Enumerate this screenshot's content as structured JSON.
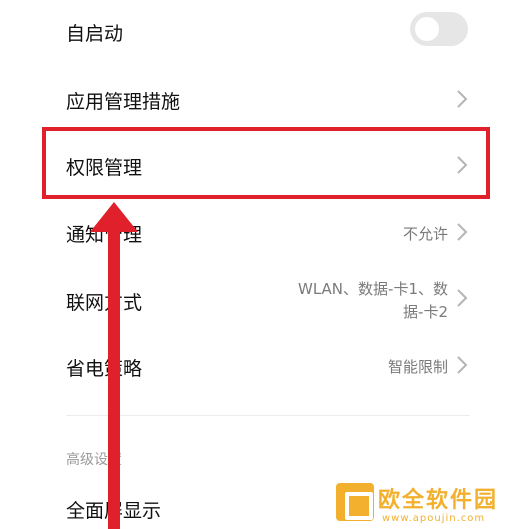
{
  "settings": {
    "auto_start": {
      "label": "自启动",
      "toggle_on": false
    },
    "app_management": {
      "label": "应用管理措施"
    },
    "permissions": {
      "label": "权限管理"
    },
    "notifications": {
      "label": "通知管理",
      "value": "不允许"
    },
    "network": {
      "label": "联网方式",
      "value_line1": "WLAN、数据-卡1、数",
      "value_line2": "据-卡2"
    },
    "power": {
      "label": "省电策略",
      "value": "智能限制"
    },
    "advanced_header": "高级设置",
    "fullscreen": {
      "label": "全面屏显示"
    }
  },
  "watermark": {
    "title": "欧全软件园",
    "url": "www.apoujin.com"
  },
  "colors": {
    "highlight": "#e0202a",
    "toggle_off": "#e6e6e6",
    "watermark": "#f2b02e"
  }
}
